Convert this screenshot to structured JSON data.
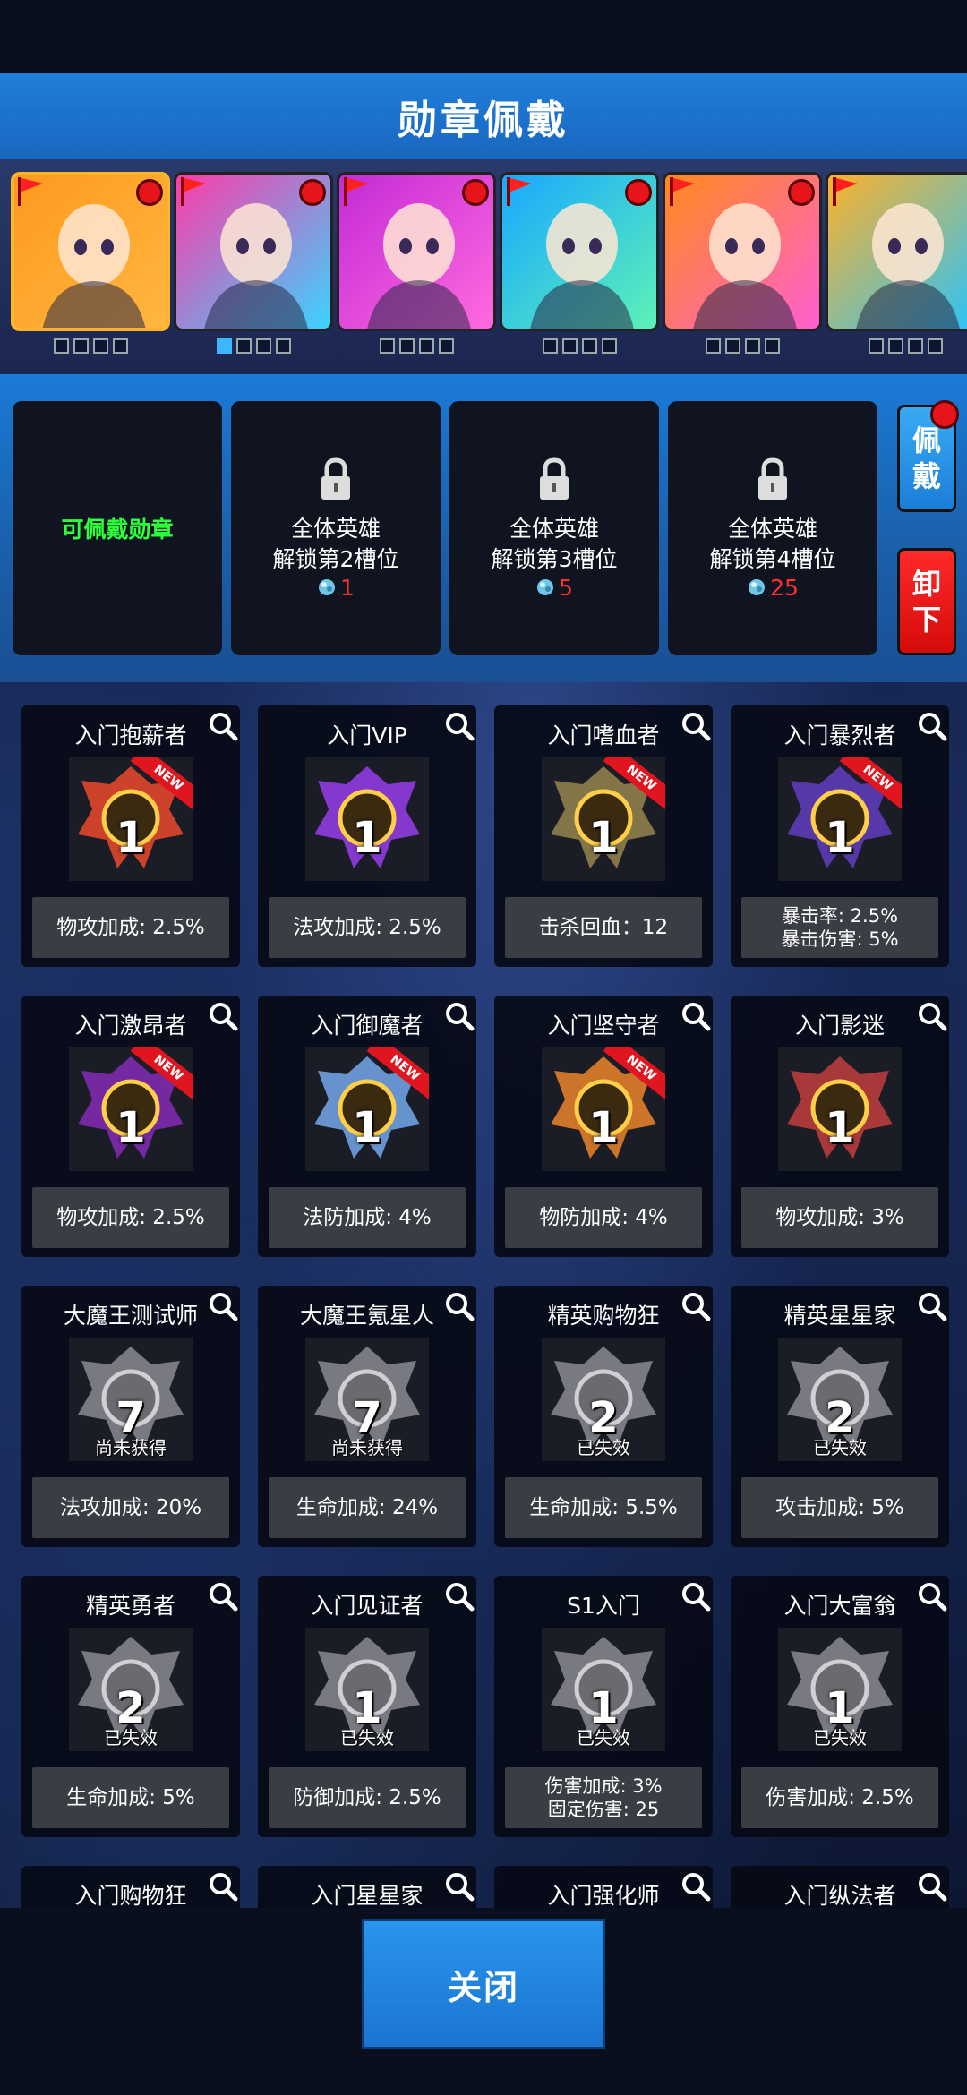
{
  "header": {
    "title": "勋章佩戴"
  },
  "heroes": [
    {
      "name": "hero-1",
      "selected": true,
      "slots_filled": 0,
      "colors": [
        "#ff9a1f",
        "#ffb640"
      ]
    },
    {
      "name": "hero-2",
      "selected": false,
      "slots_filled": 1,
      "colors": [
        "#ff3aa8",
        "#3ad4ff"
      ]
    },
    {
      "name": "hero-3",
      "selected": false,
      "slots_filled": 0,
      "colors": [
        "#c32bd6",
        "#ff6adf"
      ]
    },
    {
      "name": "hero-4",
      "selected": false,
      "slots_filled": 0,
      "colors": [
        "#19a8ff",
        "#5cf2b8"
      ]
    },
    {
      "name": "hero-5",
      "selected": false,
      "slots_filled": 0,
      "colors": [
        "#ff8a1c",
        "#ff5fd0"
      ]
    },
    {
      "name": "hero-6",
      "selected": false,
      "slots_filled": 0,
      "colors": [
        "#ffb12a",
        "#25c4ff"
      ]
    }
  ],
  "slots": {
    "open_label": "可佩戴勋章",
    "locked": [
      {
        "line1": "全体英雄",
        "line2": "解锁第2槽位",
        "cost": "1"
      },
      {
        "line1": "全体英雄",
        "line2": "解锁第3槽位",
        "cost": "5"
      },
      {
        "line1": "全体英雄",
        "line2": "解锁第4槽位",
        "cost": "25"
      }
    ]
  },
  "buttons": {
    "wear": "佩\n戴",
    "remove": "卸\n下",
    "close": "关闭"
  },
  "medals": [
    {
      "title": "入门抱薪者",
      "level": "1",
      "new": true,
      "status": "",
      "stats": [
        "物攻加成: 2.5%"
      ],
      "color": "#d6452a"
    },
    {
      "title": "入门VIP",
      "level": "1",
      "new": false,
      "status": "",
      "stats": [
        "法攻加成: 2.5%"
      ],
      "color": "#8a3ad6"
    },
    {
      "title": "入门嗜血者",
      "level": "1",
      "new": true,
      "status": "",
      "stats": [
        "击杀回血：12"
      ],
      "color": "#8a7a4a"
    },
    {
      "title": "入门暴烈者",
      "level": "1",
      "new": true,
      "status": "",
      "stats": [
        "暴击率: 2.5%",
        "暴击伤害: 5%"
      ],
      "color": "#5a3ab0"
    },
    {
      "title": "入门激昂者",
      "level": "1",
      "new": true,
      "status": "",
      "stats": [
        "物攻加成: 2.5%"
      ],
      "color": "#7a2aa8"
    },
    {
      "title": "入门御魔者",
      "level": "1",
      "new": true,
      "status": "",
      "stats": [
        "法防加成: 4%"
      ],
      "color": "#6a9ad6"
    },
    {
      "title": "入门坚守者",
      "level": "1",
      "new": true,
      "status": "",
      "stats": [
        "物防加成: 4%"
      ],
      "color": "#d67a2a"
    },
    {
      "title": "入门影迷",
      "level": "1",
      "new": false,
      "status": "",
      "stats": [
        "物攻加成: 3%"
      ],
      "color": "#b03a3a"
    },
    {
      "title": "大魔王测试师",
      "level": "7",
      "new": false,
      "status": "尚未获得",
      "stats": [
        "法攻加成: 20%"
      ],
      "color": "#9a9aa0"
    },
    {
      "title": "大魔王氪星人",
      "level": "7",
      "new": false,
      "status": "尚未获得",
      "stats": [
        "生命加成: 24%"
      ],
      "color": "#9a9aa0"
    },
    {
      "title": "精英购物狂",
      "level": "2",
      "new": false,
      "status": "已失效",
      "stats": [
        "生命加成: 5.5%"
      ],
      "color": "#9a9aa0"
    },
    {
      "title": "精英星星家",
      "level": "2",
      "new": false,
      "status": "已失效",
      "stats": [
        "攻击加成: 5%"
      ],
      "color": "#9a9aa0"
    },
    {
      "title": "精英勇者",
      "level": "2",
      "new": false,
      "status": "已失效",
      "stats": [
        "生命加成: 5%"
      ],
      "color": "#9a9aa0"
    },
    {
      "title": "入门见证者",
      "level": "1",
      "new": false,
      "status": "已失效",
      "stats": [
        "防御加成: 2.5%"
      ],
      "color": "#9a9aa0"
    },
    {
      "title": "S1入门",
      "level": "1",
      "new": false,
      "status": "已失效",
      "stats": [
        "伤害加成: 3%",
        "固定伤害: 25"
      ],
      "color": "#9a9aa0"
    },
    {
      "title": "入门大富翁",
      "level": "1",
      "new": false,
      "status": "已失效",
      "stats": [
        "伤害加成: 2.5%"
      ],
      "color": "#9a9aa0"
    },
    {
      "title": "入门购物狂",
      "level": "",
      "new": false,
      "status": "",
      "stats": [],
      "color": "#9a9aa0"
    },
    {
      "title": "入门星星家",
      "level": "",
      "new": false,
      "status": "",
      "stats": [],
      "color": "#9a9aa0"
    },
    {
      "title": "入门强化师",
      "level": "",
      "new": false,
      "status": "",
      "stats": [],
      "color": "#9a9aa0"
    },
    {
      "title": "入门纵法者",
      "level": "",
      "new": false,
      "status": "",
      "stats": [],
      "color": "#9a9aa0"
    }
  ]
}
